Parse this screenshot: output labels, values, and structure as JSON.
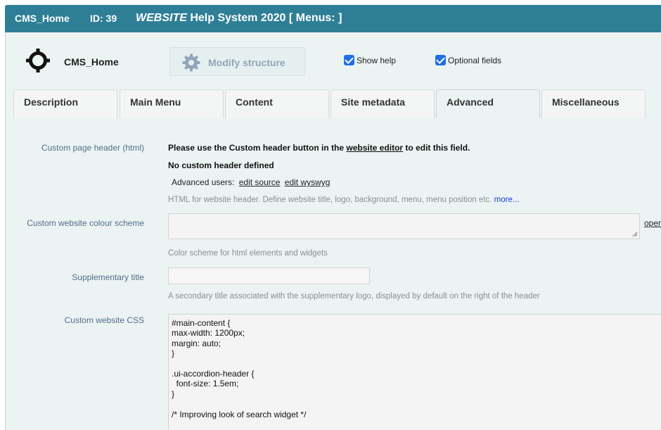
{
  "titlebar": {
    "page_name": "CMS_Home",
    "id_text": "ID: 39",
    "system_brand": "WEBSITE",
    "system_rest": " Help System 2020 [ Menus: ]"
  },
  "header": {
    "page_name": "CMS_Home",
    "modify_label": "Modify structure",
    "show_help_label": "Show help",
    "optional_fields_label": "Optional fields"
  },
  "tabs": [
    {
      "label": "Description"
    },
    {
      "label": "Main Menu"
    },
    {
      "label": "Content"
    },
    {
      "label": "Site metadata"
    },
    {
      "label": "Advanced"
    },
    {
      "label": "Miscellaneous"
    }
  ],
  "fields": {
    "custom_header": {
      "label": "Custom page header (html)",
      "notice_prefix": "Please use the Custom header button in the ",
      "notice_link": "website editor",
      "notice_suffix": " to edit this field.",
      "status": "No custom header defined",
      "advanced_label": "Advanced users:",
      "edit_source": "edit source",
      "edit_wysiwyg": "edit wyswyg",
      "help": "HTML for website header. Define website title, logo, background, menu, menu position etc.",
      "more": "more..."
    },
    "colour_scheme": {
      "label": "Custom website colour scheme",
      "value": "",
      "open_link": "open",
      "help": "Color scheme for html elements and widgets"
    },
    "supplementary_title": {
      "label": "Supplementary title",
      "value": "",
      "help": "A secondary title associated with the supplementary logo, displayed by default on the right of the header"
    },
    "custom_css": {
      "label": "Custom website CSS",
      "value": "#main-content {\nmax-width: 1200px;\nmargin: auto;\n}\n\n.ui-accordion-header {\n  font-size: 1.5em;\n}\n\n/* Improving look of search widget */\n\n.ui-heurist-header.truncate {"
    }
  },
  "colors": {
    "titlebar": "#2e7f96",
    "panel_bg": "#ecf3f3",
    "label": "#4e6f8c",
    "checkbox": "#1f6fe5"
  }
}
